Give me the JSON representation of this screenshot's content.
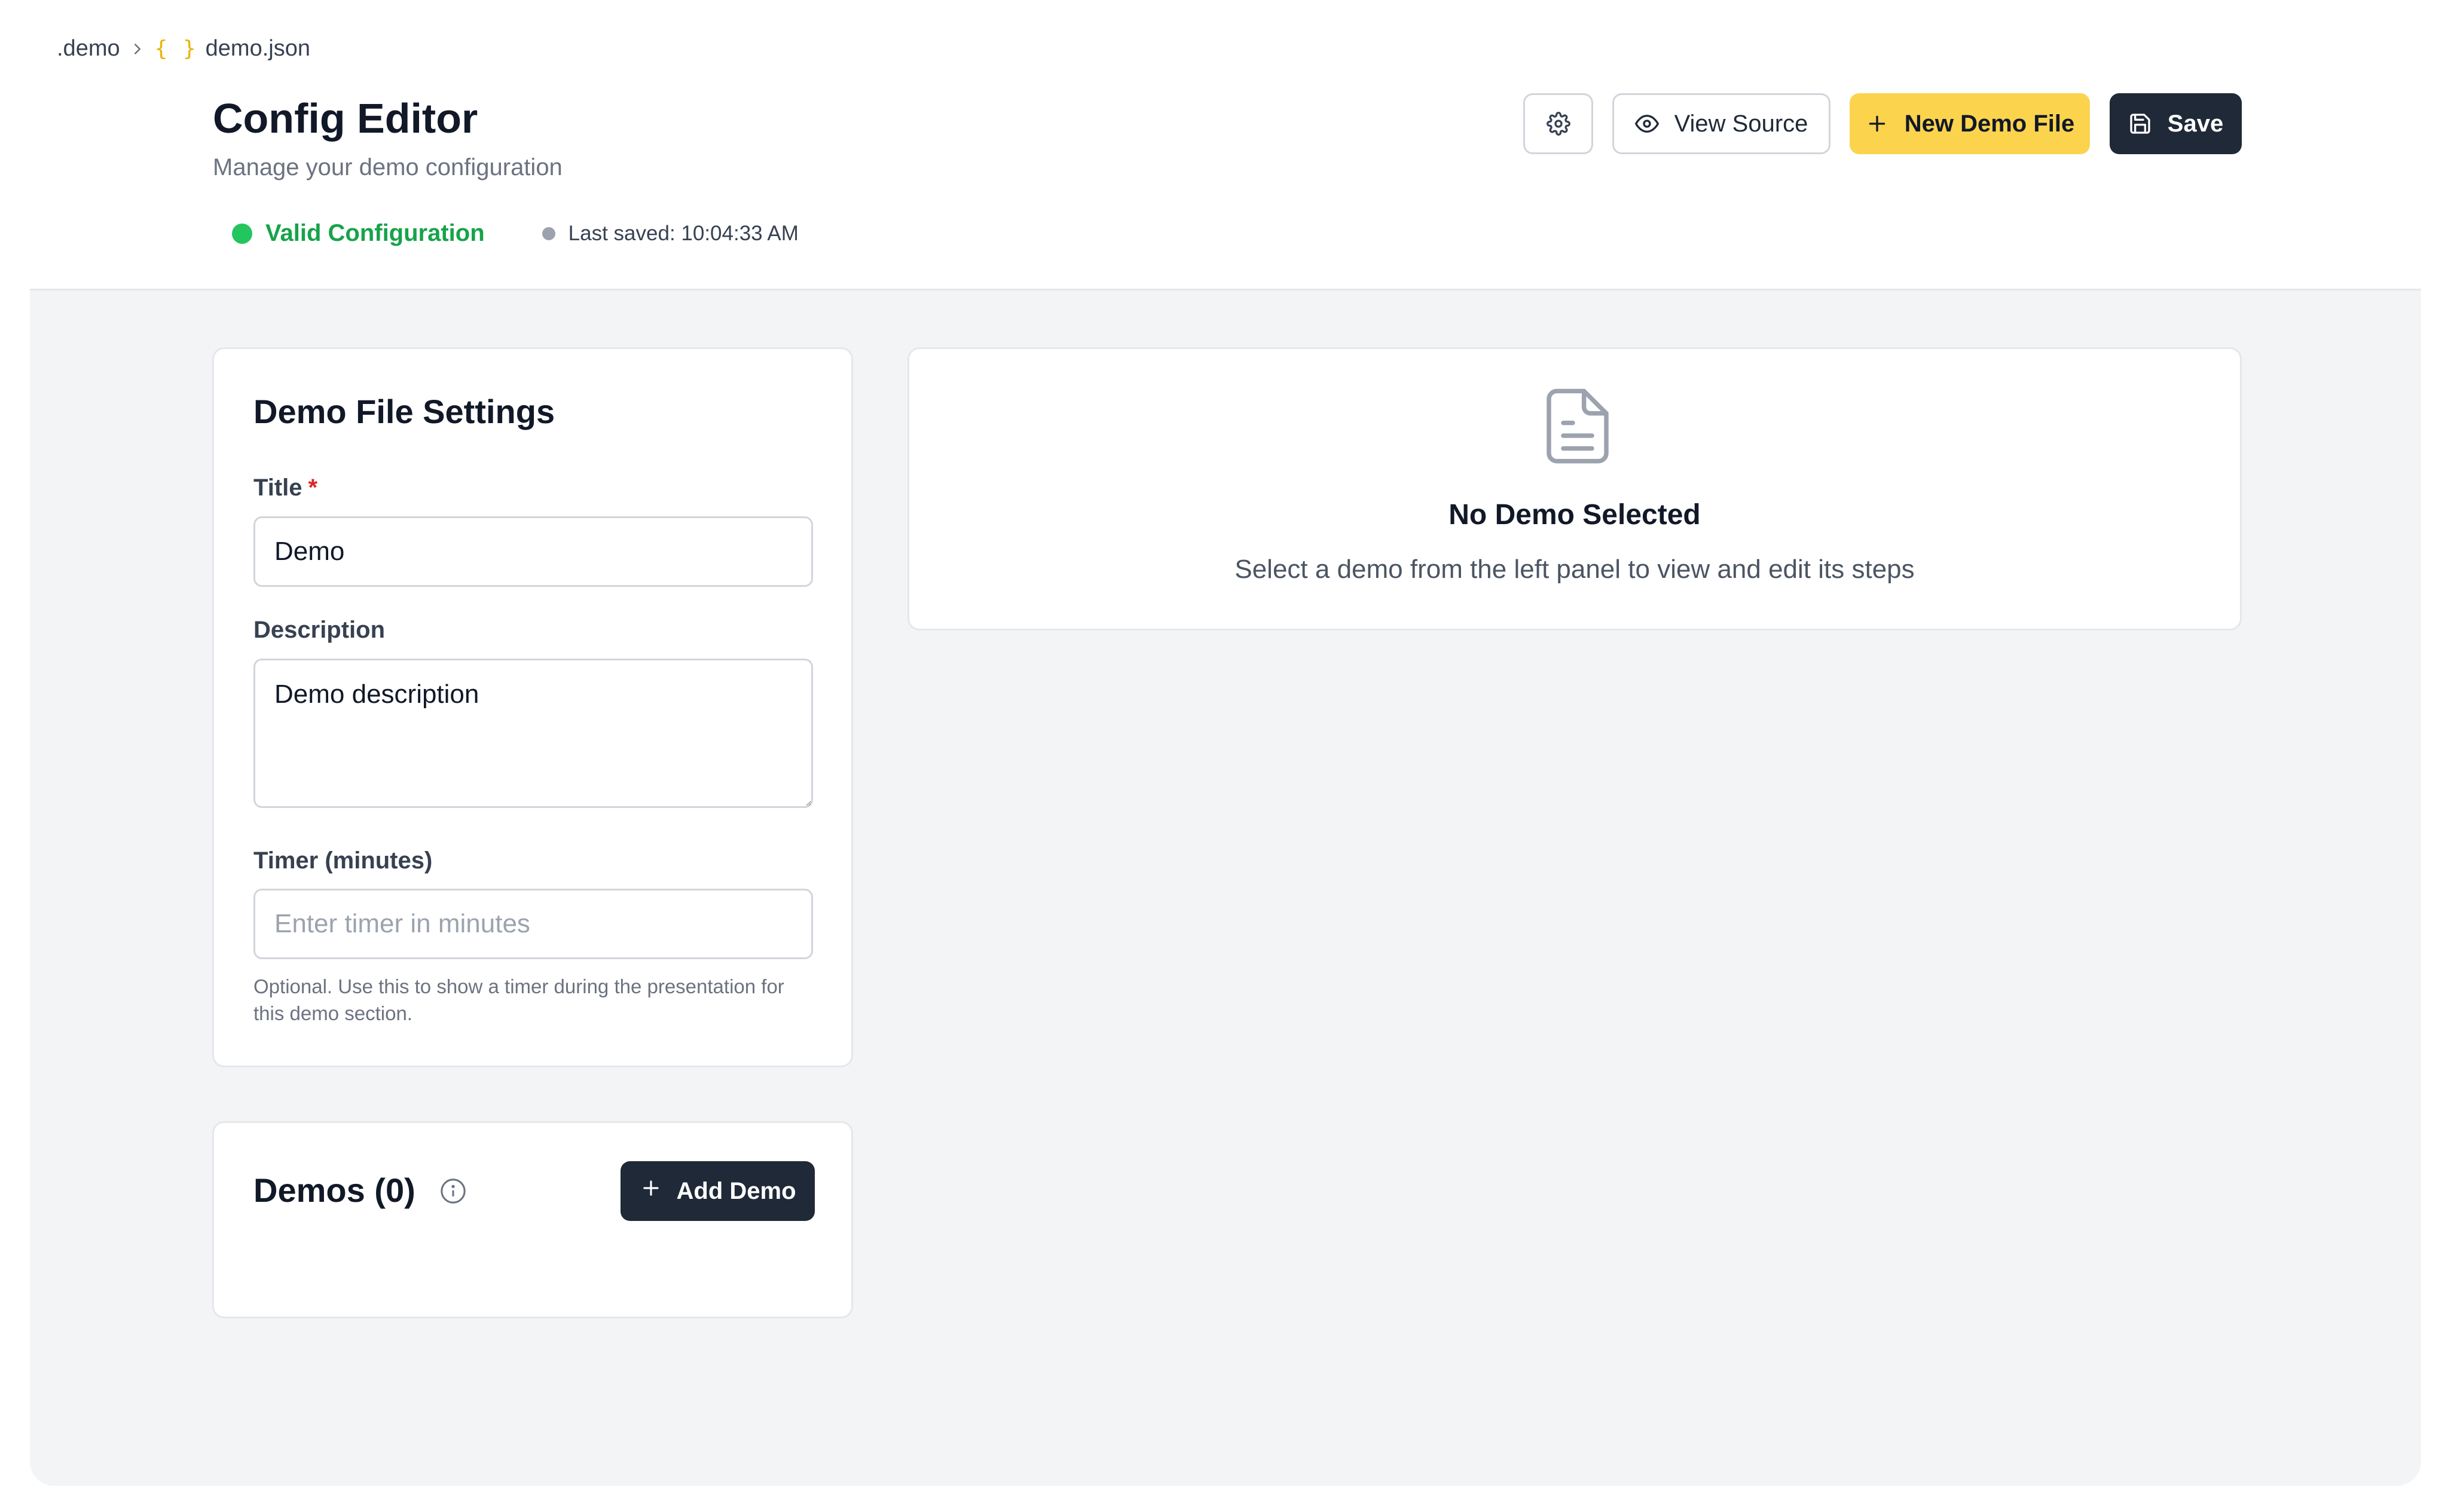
{
  "breadcrumb": {
    "root": ".demo",
    "file_icon": "{ }",
    "file": "demo.json"
  },
  "header": {
    "title": "Config Editor",
    "subtitle": "Manage your demo configuration",
    "status_valid": "Valid Configuration",
    "last_saved": "Last saved: 10:04:33 AM"
  },
  "toolbar": {
    "settings_icon": "gear-icon",
    "view_source_label": "View Source",
    "new_file_label": "New Demo File",
    "save_label": "Save"
  },
  "settings_card": {
    "heading": "Demo File Settings",
    "title_label": "Title",
    "required_mark": "*",
    "title_value": "Demo",
    "description_label": "Description",
    "description_value": "Demo description",
    "timer_label": "Timer (minutes)",
    "timer_value": "",
    "timer_placeholder": "Enter timer in minutes",
    "timer_help": "Optional. Use this to show a timer during the presentation for this demo section."
  },
  "demos_card": {
    "heading": "Demos (0)",
    "add_label": "Add Demo"
  },
  "empty_state": {
    "title": "No Demo Selected",
    "text": "Select a demo from the left panel to view and edit its steps"
  },
  "colors": {
    "accent_yellow": "#fcd34d",
    "dark_button": "#1f2937",
    "valid_green": "#22c55e",
    "json_icon": "#eab308"
  }
}
